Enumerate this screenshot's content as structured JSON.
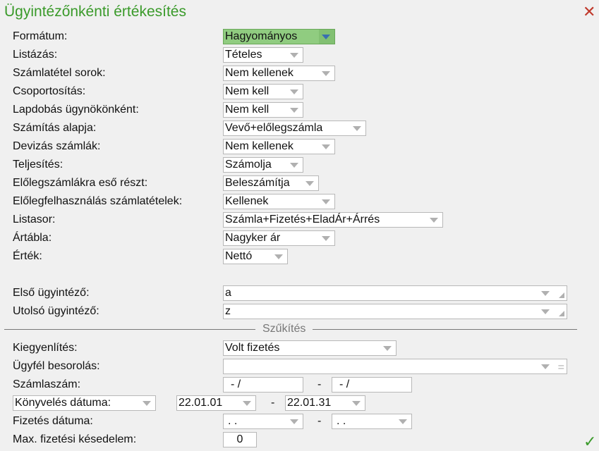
{
  "title": "Ügyintézőnkénti értékesítés",
  "icons": {
    "close": "close-icon",
    "ok": "checkmark-icon"
  },
  "fields": [
    {
      "label": "Formátum:",
      "value": "Hagyományos"
    },
    {
      "label": "Listázás:",
      "value": "Tételes"
    },
    {
      "label": "Számlatétel sorok:",
      "value": "Nem kellenek"
    },
    {
      "label": "Csoportosítás:",
      "value": "Nem kell"
    },
    {
      "label": "Lapdobás ügynökönként:",
      "value": "Nem kell"
    },
    {
      "label": "Számítás alapja:",
      "value": "Vevő+előlegszámla"
    },
    {
      "label": "Devizás számlák:",
      "value": "Nem kellenek"
    },
    {
      "label": "Teljesítés:",
      "value": "Számolja"
    },
    {
      "label": "Előlegszámlákra eső részt:",
      "value": "Beleszámítja"
    },
    {
      "label": "Előlegfelhasználás számlatételek:",
      "value": "Kellenek"
    },
    {
      "label": "Listasor:",
      "value": "Számla+Fizetés+EladÁr+Árrés"
    },
    {
      "label": "Ártábla:",
      "value": "Nagyker ár"
    },
    {
      "label": "Érték:",
      "value": "Nettó"
    }
  ],
  "first_agent": {
    "label": "Első ügyintéző:",
    "value": "a"
  },
  "last_agent": {
    "label": "Utolsó ügyintéző:",
    "value": "z"
  },
  "section": "Szűkítés",
  "settlement": {
    "label": "Kiegyenlítés:",
    "value": "Volt fizetés"
  },
  "customer_class": {
    "label": "Ügyfél besorolás:",
    "value": ""
  },
  "invoice_no": {
    "label": "Számlaszám:",
    "from": "- /",
    "to": "- /"
  },
  "booking_date": {
    "type": "Könyvelés dátuma:",
    "from": "22.01.01",
    "to": "22.01.31"
  },
  "payment_date": {
    "label": "Fizetés dátuma:",
    "from": ". .",
    "to": ". ."
  },
  "max_delay": {
    "label": "Max. fizetési késedelem:",
    "value": "0"
  },
  "dash": "-"
}
